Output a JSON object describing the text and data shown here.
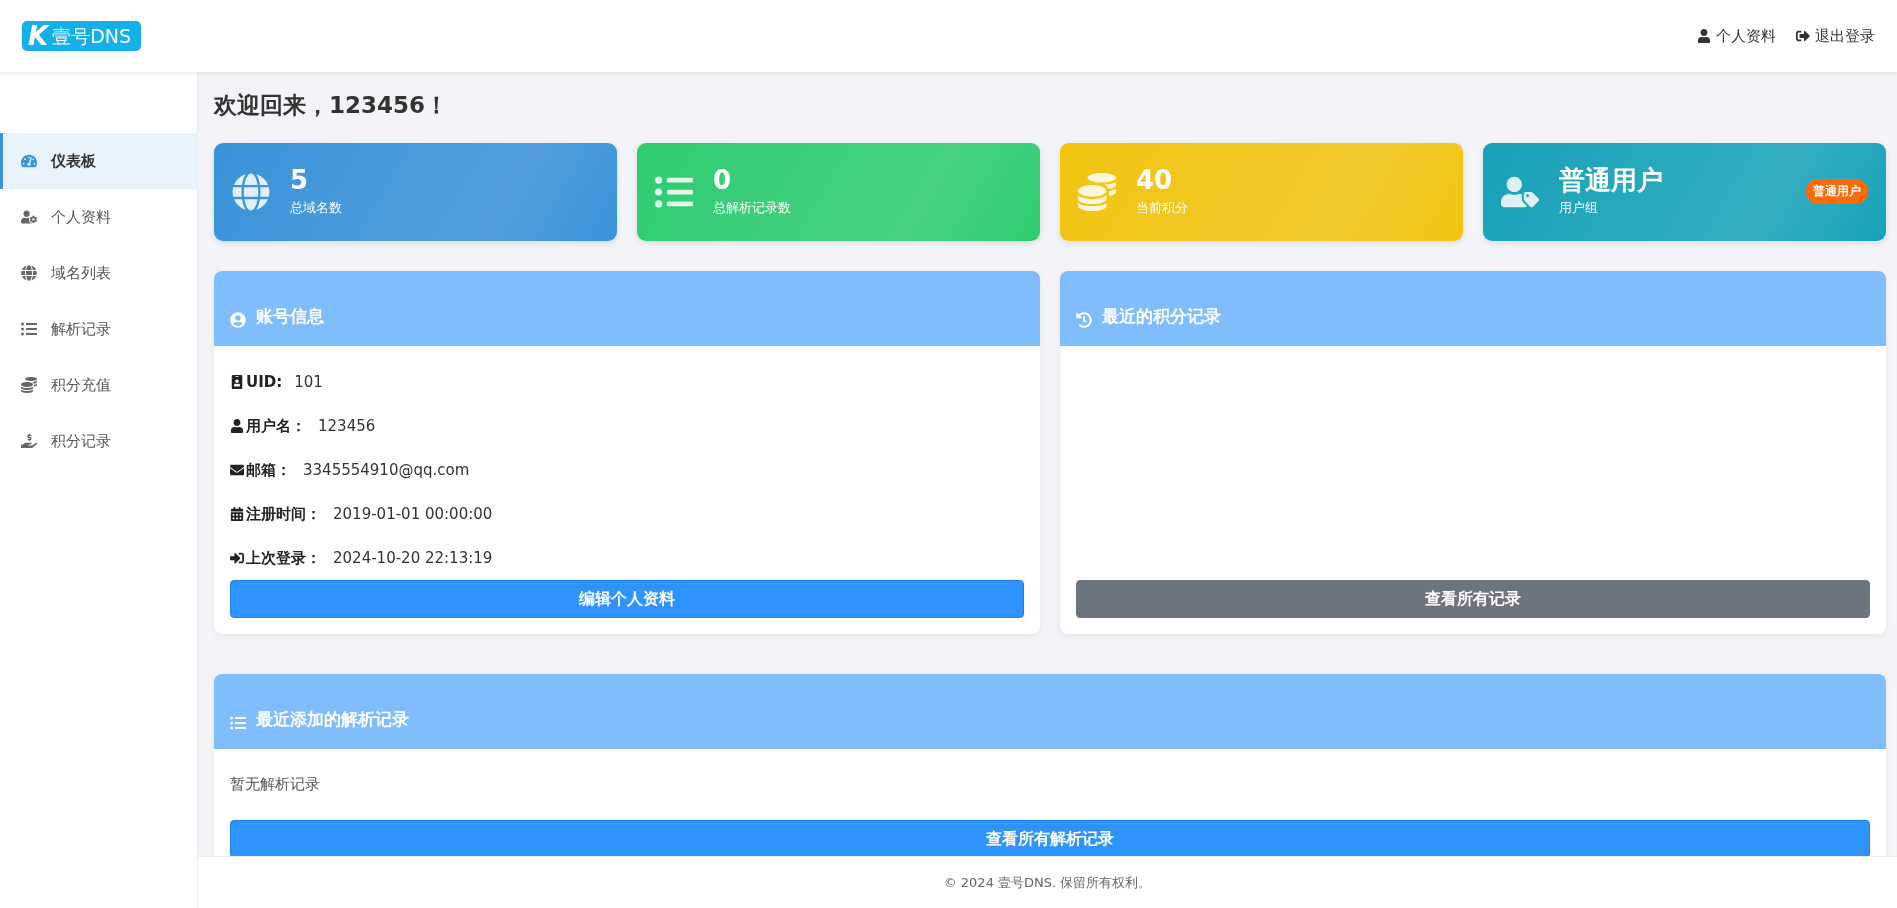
{
  "header": {
    "logo": {
      "mark": "K",
      "text": "壹号DNS"
    },
    "links": [
      {
        "label": "个人资料",
        "kind": "user"
      },
      {
        "label": "退出登录",
        "kind": "logout"
      }
    ]
  },
  "sidebar": {
    "items": [
      {
        "label": "仪表板",
        "kind": "gauge",
        "selected": true
      },
      {
        "label": "个人资料",
        "kind": "user-cog",
        "selected": false
      },
      {
        "label": "域名列表",
        "kind": "globe",
        "selected": false
      },
      {
        "label": "解析记录",
        "kind": "list",
        "selected": false
      },
      {
        "label": "积分充值",
        "kind": "coins",
        "selected": false
      },
      {
        "label": "积分记录",
        "kind": "hand-money",
        "selected": false
      }
    ]
  },
  "page_title": "欢迎回来，123456！",
  "stats": [
    {
      "value": "5",
      "label": "总域名数",
      "kind": "globe",
      "color": "#3a92d8"
    },
    {
      "value": "0",
      "label": "总解析记录数",
      "kind": "list",
      "color": "#2ecc71"
    },
    {
      "value": "40",
      "label": "当前积分",
      "kind": "coins",
      "color": "#f1c40f"
    },
    {
      "value": "普通用户",
      "label": "用户组",
      "kind": "user-tag",
      "color": "#17a2b8",
      "badge": "普通用户"
    }
  ],
  "account_card": {
    "title": "账号信息",
    "rows": [
      {
        "kind": "id",
        "label": "UID:",
        "value": "101"
      },
      {
        "kind": "user",
        "label": "用户名：",
        "value": "123456"
      },
      {
        "kind": "mail",
        "label": "邮箱：",
        "value": "3345554910@qq.com"
      },
      {
        "kind": "calendar",
        "label": "注册时间：",
        "value": "2019-01-01 00:00:00"
      },
      {
        "kind": "login",
        "label": "上次登录：",
        "value": "2024-10-20 22:13:19"
      }
    ],
    "button": "编辑个人资料"
  },
  "points_card": {
    "title": "最近的积分记录",
    "button": "查看所有记录"
  },
  "records_card": {
    "title": "最近添加的解析记录",
    "empty_text": "暂无解析记录",
    "button": "查看所有解析记录"
  },
  "footer": "© 2024 壹号DNS. 保留所有权利。"
}
